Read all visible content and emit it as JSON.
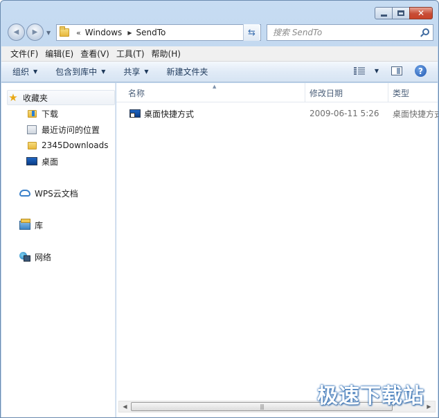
{
  "window": {
    "caption_buttons": {
      "close_glyph": "✕"
    }
  },
  "nav": {
    "back_glyph": "◀",
    "forward_glyph": "▶",
    "address": {
      "chevron": "«",
      "crumbs": [
        "Windows",
        "SendTo"
      ]
    },
    "refresh_glyph": "⇆",
    "search": {
      "placeholder": "搜索 SendTo"
    }
  },
  "menubar": {
    "items": [
      "文件(F)",
      "编辑(E)",
      "查看(V)",
      "工具(T)",
      "帮助(H)"
    ]
  },
  "toolbar": {
    "organize": "组织",
    "include_in_library": "包含到库中",
    "share": "共享",
    "new_folder": "新建文件夹",
    "help_glyph": "?"
  },
  "navpane": {
    "favorites": "收藏夹",
    "favorites_items": [
      "下载",
      "最近访问的位置",
      "2345Downloads",
      "桌面"
    ],
    "wps": "WPS云文档",
    "library": "库",
    "network": "网络"
  },
  "columns": {
    "name": "名称",
    "date": "修改日期",
    "type": "类型"
  },
  "files": [
    {
      "name": "桌面快捷方式",
      "date": "2009-06-11 5:26",
      "type": "桌面快捷方式"
    }
  ],
  "scrollbar": {
    "grip": "|||"
  },
  "watermark": "极速下载站",
  "colors": {
    "frame": "#c2d8f0",
    "toolbar_text": "#1e395b",
    "header_text": "#4c607a",
    "secondary_text": "#6d6d6d",
    "watermark_outline": "#2d6fb8"
  }
}
